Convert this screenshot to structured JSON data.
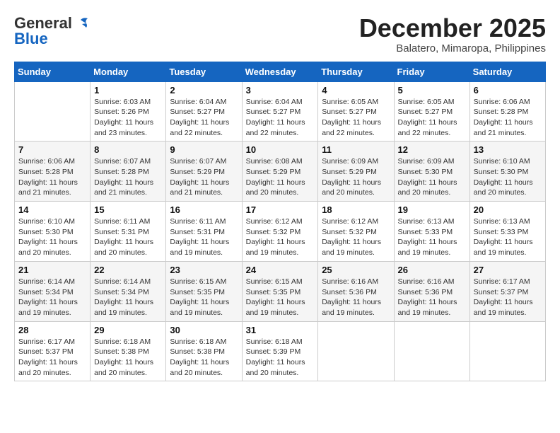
{
  "header": {
    "logo_general": "General",
    "logo_blue": "Blue",
    "month": "December 2025",
    "location": "Balatero, Mimaropa, Philippines"
  },
  "days_of_week": [
    "Sunday",
    "Monday",
    "Tuesday",
    "Wednesday",
    "Thursday",
    "Friday",
    "Saturday"
  ],
  "weeks": [
    [
      {
        "num": "",
        "sunrise": "",
        "sunset": "",
        "daylight": ""
      },
      {
        "num": "1",
        "sunrise": "Sunrise: 6:03 AM",
        "sunset": "Sunset: 5:26 PM",
        "daylight": "Daylight: 11 hours and 23 minutes."
      },
      {
        "num": "2",
        "sunrise": "Sunrise: 6:04 AM",
        "sunset": "Sunset: 5:27 PM",
        "daylight": "Daylight: 11 hours and 22 minutes."
      },
      {
        "num": "3",
        "sunrise": "Sunrise: 6:04 AM",
        "sunset": "Sunset: 5:27 PM",
        "daylight": "Daylight: 11 hours and 22 minutes."
      },
      {
        "num": "4",
        "sunrise": "Sunrise: 6:05 AM",
        "sunset": "Sunset: 5:27 PM",
        "daylight": "Daylight: 11 hours and 22 minutes."
      },
      {
        "num": "5",
        "sunrise": "Sunrise: 6:05 AM",
        "sunset": "Sunset: 5:27 PM",
        "daylight": "Daylight: 11 hours and 22 minutes."
      },
      {
        "num": "6",
        "sunrise": "Sunrise: 6:06 AM",
        "sunset": "Sunset: 5:28 PM",
        "daylight": "Daylight: 11 hours and 21 minutes."
      }
    ],
    [
      {
        "num": "7",
        "sunrise": "Sunrise: 6:06 AM",
        "sunset": "Sunset: 5:28 PM",
        "daylight": "Daylight: 11 hours and 21 minutes."
      },
      {
        "num": "8",
        "sunrise": "Sunrise: 6:07 AM",
        "sunset": "Sunset: 5:28 PM",
        "daylight": "Daylight: 11 hours and 21 minutes."
      },
      {
        "num": "9",
        "sunrise": "Sunrise: 6:07 AM",
        "sunset": "Sunset: 5:29 PM",
        "daylight": "Daylight: 11 hours and 21 minutes."
      },
      {
        "num": "10",
        "sunrise": "Sunrise: 6:08 AM",
        "sunset": "Sunset: 5:29 PM",
        "daylight": "Daylight: 11 hours and 20 minutes."
      },
      {
        "num": "11",
        "sunrise": "Sunrise: 6:09 AM",
        "sunset": "Sunset: 5:29 PM",
        "daylight": "Daylight: 11 hours and 20 minutes."
      },
      {
        "num": "12",
        "sunrise": "Sunrise: 6:09 AM",
        "sunset": "Sunset: 5:30 PM",
        "daylight": "Daylight: 11 hours and 20 minutes."
      },
      {
        "num": "13",
        "sunrise": "Sunrise: 6:10 AM",
        "sunset": "Sunset: 5:30 PM",
        "daylight": "Daylight: 11 hours and 20 minutes."
      }
    ],
    [
      {
        "num": "14",
        "sunrise": "Sunrise: 6:10 AM",
        "sunset": "Sunset: 5:30 PM",
        "daylight": "Daylight: 11 hours and 20 minutes."
      },
      {
        "num": "15",
        "sunrise": "Sunrise: 6:11 AM",
        "sunset": "Sunset: 5:31 PM",
        "daylight": "Daylight: 11 hours and 20 minutes."
      },
      {
        "num": "16",
        "sunrise": "Sunrise: 6:11 AM",
        "sunset": "Sunset: 5:31 PM",
        "daylight": "Daylight: 11 hours and 19 minutes."
      },
      {
        "num": "17",
        "sunrise": "Sunrise: 6:12 AM",
        "sunset": "Sunset: 5:32 PM",
        "daylight": "Daylight: 11 hours and 19 minutes."
      },
      {
        "num": "18",
        "sunrise": "Sunrise: 6:12 AM",
        "sunset": "Sunset: 5:32 PM",
        "daylight": "Daylight: 11 hours and 19 minutes."
      },
      {
        "num": "19",
        "sunrise": "Sunrise: 6:13 AM",
        "sunset": "Sunset: 5:33 PM",
        "daylight": "Daylight: 11 hours and 19 minutes."
      },
      {
        "num": "20",
        "sunrise": "Sunrise: 6:13 AM",
        "sunset": "Sunset: 5:33 PM",
        "daylight": "Daylight: 11 hours and 19 minutes."
      }
    ],
    [
      {
        "num": "21",
        "sunrise": "Sunrise: 6:14 AM",
        "sunset": "Sunset: 5:34 PM",
        "daylight": "Daylight: 11 hours and 19 minutes."
      },
      {
        "num": "22",
        "sunrise": "Sunrise: 6:14 AM",
        "sunset": "Sunset: 5:34 PM",
        "daylight": "Daylight: 11 hours and 19 minutes."
      },
      {
        "num": "23",
        "sunrise": "Sunrise: 6:15 AM",
        "sunset": "Sunset: 5:35 PM",
        "daylight": "Daylight: 11 hours and 19 minutes."
      },
      {
        "num": "24",
        "sunrise": "Sunrise: 6:15 AM",
        "sunset": "Sunset: 5:35 PM",
        "daylight": "Daylight: 11 hours and 19 minutes."
      },
      {
        "num": "25",
        "sunrise": "Sunrise: 6:16 AM",
        "sunset": "Sunset: 5:36 PM",
        "daylight": "Daylight: 11 hours and 19 minutes."
      },
      {
        "num": "26",
        "sunrise": "Sunrise: 6:16 AM",
        "sunset": "Sunset: 5:36 PM",
        "daylight": "Daylight: 11 hours and 19 minutes."
      },
      {
        "num": "27",
        "sunrise": "Sunrise: 6:17 AM",
        "sunset": "Sunset: 5:37 PM",
        "daylight": "Daylight: 11 hours and 19 minutes."
      }
    ],
    [
      {
        "num": "28",
        "sunrise": "Sunrise: 6:17 AM",
        "sunset": "Sunset: 5:37 PM",
        "daylight": "Daylight: 11 hours and 20 minutes."
      },
      {
        "num": "29",
        "sunrise": "Sunrise: 6:18 AM",
        "sunset": "Sunset: 5:38 PM",
        "daylight": "Daylight: 11 hours and 20 minutes."
      },
      {
        "num": "30",
        "sunrise": "Sunrise: 6:18 AM",
        "sunset": "Sunset: 5:38 PM",
        "daylight": "Daylight: 11 hours and 20 minutes."
      },
      {
        "num": "31",
        "sunrise": "Sunrise: 6:18 AM",
        "sunset": "Sunset: 5:39 PM",
        "daylight": "Daylight: 11 hours and 20 minutes."
      },
      {
        "num": "",
        "sunrise": "",
        "sunset": "",
        "daylight": ""
      },
      {
        "num": "",
        "sunrise": "",
        "sunset": "",
        "daylight": ""
      },
      {
        "num": "",
        "sunrise": "",
        "sunset": "",
        "daylight": ""
      }
    ]
  ]
}
